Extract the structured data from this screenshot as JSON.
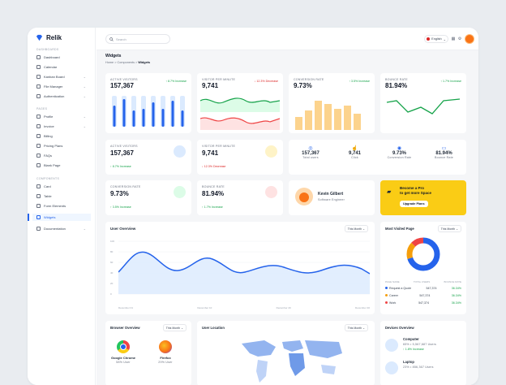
{
  "brand": {
    "name": "Relik"
  },
  "sidebar": {
    "sections": [
      "DASHBOARDS",
      "PAGES",
      "COMPONENTS"
    ],
    "items": [
      {
        "label": "Dashboard"
      },
      {
        "label": "Calendar"
      },
      {
        "label": "Kanban Board"
      },
      {
        "label": "File Manager"
      },
      {
        "label": "Authentication"
      },
      {
        "label": "Profile"
      },
      {
        "label": "Invoice"
      },
      {
        "label": "Billing"
      },
      {
        "label": "Pricing Plans"
      },
      {
        "label": "FAQs"
      },
      {
        "label": "Blank Page"
      },
      {
        "label": "Card"
      },
      {
        "label": "Table"
      },
      {
        "label": "Form Elements"
      },
      {
        "label": "Widgets"
      },
      {
        "label": "Documentation"
      }
    ]
  },
  "topbar": {
    "search_placeholder": "Search",
    "language": "English"
  },
  "page": {
    "title": "Widgets",
    "crumb_home": "Home",
    "crumb_components": "Components",
    "crumb_current": "Widgets"
  },
  "row1": [
    {
      "label": "ACTIVE VISITORS",
      "value": "157,367",
      "change": "8.7% Increase"
    },
    {
      "label": "VISITOR PER MINUTE",
      "value": "9,741",
      "change": "12.3% Decrease"
    },
    {
      "label": "CONVERSION RATE",
      "value": "9.73%",
      "change": "3.5% Increase"
    },
    {
      "label": "BOUNCE RATE",
      "value": "81.94%",
      "change": "1.7% Increase"
    }
  ],
  "row2": [
    {
      "label": "ACTIVE VISITORS",
      "value": "157,367",
      "change": "8.7% Increase"
    },
    {
      "label": "VISITOR PER MINUTE",
      "value": "9,741",
      "change": "12.3% Decrease"
    }
  ],
  "summary": [
    {
      "value": "157,367",
      "label": "Total users"
    },
    {
      "value": "9,741",
      "label": "Click"
    },
    {
      "value": "9.73%",
      "label": "Conversion Rate"
    },
    {
      "value": "81.94%",
      "label": "Bounce Rate"
    }
  ],
  "row3": [
    {
      "label": "CONVERSION RATE",
      "value": "9.73%",
      "change": "3.5% Increase"
    },
    {
      "label": "BOUNCE RATE",
      "value": "81.94%",
      "change": "1.7% Increase"
    }
  ],
  "profile": {
    "name": "Kevin Gilbert",
    "role": "Software Engineer"
  },
  "promo": {
    "line1": "Become a Pro",
    "line2": "to get more Space",
    "button": "Upgrade Plans"
  },
  "user_overview": {
    "title": "User Overview",
    "filter": "This Month",
    "y_ticks": [
      "100",
      "80",
      "60",
      "40",
      "20",
      "0"
    ],
    "x_ticks": [
      "December 01",
      "December 10",
      "December 20",
      "December 30"
    ]
  },
  "most_visited": {
    "title": "Most Visited Page",
    "filter": "This Month",
    "headers": [
      "PAGE NAME",
      "TOTAL USERS",
      "BOUNCE RATE"
    ],
    "rows": [
      {
        "name": "Request a Quote",
        "users": "547,374",
        "rate": "36.34%",
        "color": "#2563eb"
      },
      {
        "name": "Career",
        "users": "547,374",
        "rate": "36.34%",
        "color": "#f59e0b"
      },
      {
        "name": "Work",
        "users": "547,374",
        "rate": "36.34%",
        "color": "#ef4444"
      }
    ]
  },
  "browser": {
    "title": "Browser Overview",
    "filter": "This Month",
    "items": [
      {
        "name": "Google Chrome",
        "share": "58% User"
      },
      {
        "name": "Firefox",
        "share": "29% User"
      }
    ]
  },
  "location": {
    "title": "User Location",
    "filter": "This Month"
  },
  "devices": {
    "title": "Devices Overview",
    "items": [
      {
        "name": "Computer",
        "info": "65% • 5,567,687 Users",
        "change": "1.8% Increase"
      },
      {
        "name": "Laptop",
        "info": "23% • 856,367 Users"
      }
    ]
  },
  "colors": {
    "accent": "#2563eb",
    "promo": "#facc15"
  }
}
